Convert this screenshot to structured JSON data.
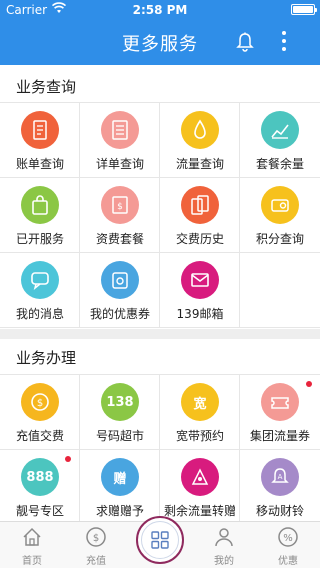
{
  "status_bar": {
    "carrier": "Carrier",
    "time": "2:58 PM"
  },
  "header": {
    "title": "更多服务",
    "bell_icon": "bell-icon",
    "more_icon": "more-vertical-icon"
  },
  "sections": [
    {
      "title": "业务查询",
      "items": [
        {
          "label": "账单查询",
          "color": "#f0623b",
          "icon": "bill-icon"
        },
        {
          "label": "详单查询",
          "color": "#f49a95",
          "icon": "detail-list-icon"
        },
        {
          "label": "流量查询",
          "color": "#f6c11d",
          "icon": "drop-icon"
        },
        {
          "label": "套餐余量",
          "color": "#4cc5bf",
          "icon": "chart-icon"
        },
        {
          "label": "已开服务",
          "color": "#8bc745",
          "icon": "bag-icon"
        },
        {
          "label": "资费套餐",
          "color": "#f49a95",
          "icon": "price-tag-icon"
        },
        {
          "label": "交费历史",
          "color": "#f0623b",
          "icon": "payment-history-icon"
        },
        {
          "label": "积分查询",
          "color": "#f6c11d",
          "icon": "points-icon"
        },
        {
          "label": "我的消息",
          "color": "#4cc5d9",
          "icon": "chat-icon"
        },
        {
          "label": "我的优惠券",
          "color": "#49a5e0",
          "icon": "coupon-icon"
        },
        {
          "label": "139邮箱",
          "color": "#d81b7e",
          "icon": "mail-icon"
        }
      ]
    },
    {
      "title": "业务办理",
      "items": [
        {
          "label": "充值交费",
          "color": "#f6b61e",
          "icon": "coin-icon"
        },
        {
          "label": "号码超市",
          "color": "#8bc745",
          "icon": "cart-icon",
          "icon_text": "138"
        },
        {
          "label": "宽带预约",
          "color": "#f6c11d",
          "icon": "broadband-icon",
          "icon_text": "宽"
        },
        {
          "label": "集团流量券",
          "color": "#f49a95",
          "icon": "ticket-icon",
          "badge": true
        },
        {
          "label": "靓号专区",
          "color": "#4cc5bf",
          "icon": "number-icon",
          "icon_text": "888",
          "badge": true
        },
        {
          "label": "求赠赠予",
          "color": "#49a5e0",
          "icon": "gift-icon",
          "icon_text": "赠"
        },
        {
          "label": "剩余流量转赠",
          "color": "#d81b7e",
          "icon": "transfer-icon"
        },
        {
          "label": "移动财铃",
          "color": "#a58ac9",
          "icon": "ringtone-icon"
        }
      ]
    }
  ],
  "tabbar": {
    "items": [
      {
        "label": "首页",
        "icon": "home-icon"
      },
      {
        "label": "充值",
        "icon": "yuan-coin-icon"
      },
      {
        "label": "",
        "icon": "grid-icon"
      },
      {
        "label": "我的",
        "icon": "user-icon"
      },
      {
        "label": "优惠",
        "icon": "discount-icon"
      }
    ],
    "center_color": "#8f2a5e"
  }
}
